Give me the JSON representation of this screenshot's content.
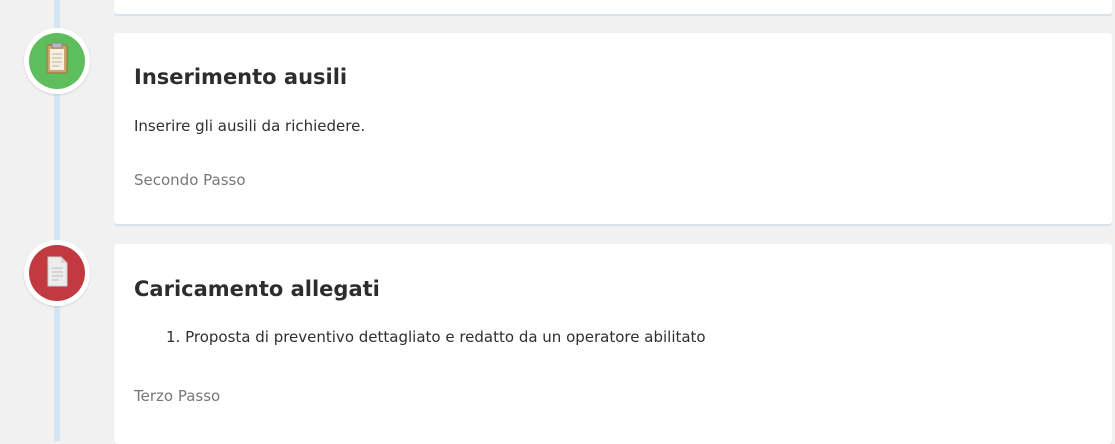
{
  "colors": {
    "background": "#f1f1f1",
    "timeline_line": "#d4e4f1",
    "step_complete": "#5fbe5c",
    "step_attachments": "#c23a3f",
    "card_background": "#ffffff"
  },
  "steps": [
    {
      "icon": "clipboard-icon",
      "title": "Inserimento ausili",
      "description": "Inserire gli ausili da richiedere.",
      "step_label": "Secondo Passo"
    },
    {
      "icon": "document-icon",
      "title": "Caricamento allegati",
      "list": [
        "1. Proposta di preventivo dettagliato e redatto da un operatore abilitato"
      ],
      "step_label": "Terzo Passo"
    }
  ]
}
